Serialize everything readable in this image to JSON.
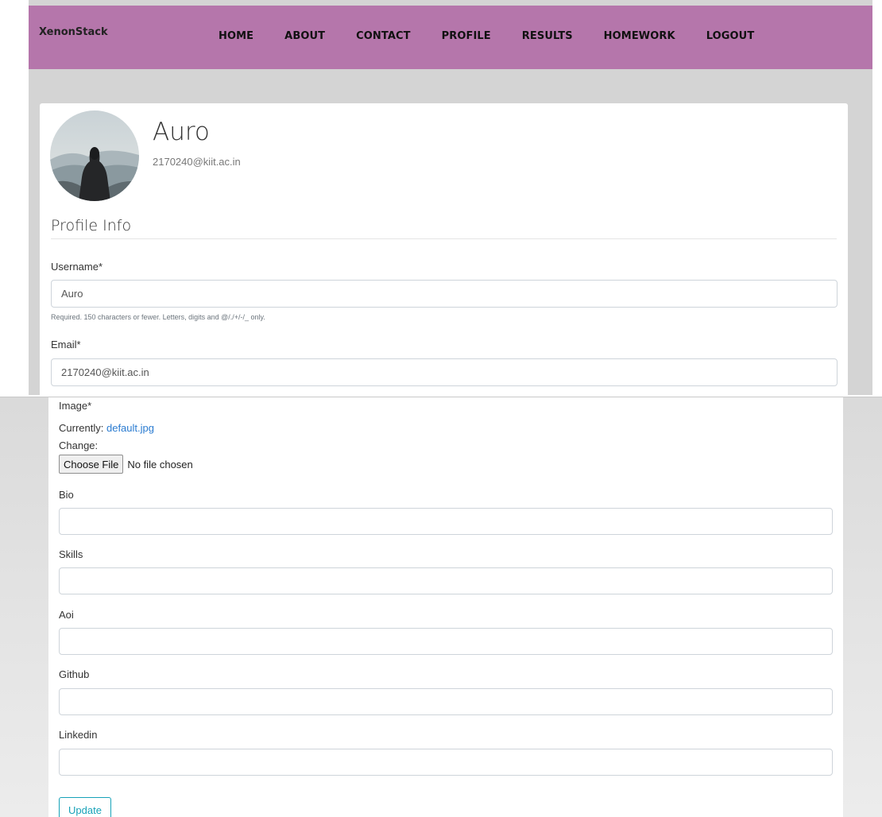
{
  "navbar": {
    "brand": "XenonStack",
    "links": [
      "HOME",
      "ABOUT",
      "CONTACT",
      "PROFILE",
      "RESULTS",
      "HOMEWORK",
      "LOGOUT"
    ],
    "background": "#b576ab"
  },
  "profile": {
    "name": "Auro",
    "email": "2170240@kiit.ac.in",
    "avatar_icon": "hooded-figure-avatar"
  },
  "section_title": "Profile Info",
  "form": {
    "username": {
      "label": "Username*",
      "value": "Auro",
      "help": "Required. 150 characters or fewer. Letters, digits and @/./+/-/_ only."
    },
    "email": {
      "label": "Email*",
      "value": "2170240@kiit.ac.in"
    },
    "image": {
      "label": "Image*",
      "currently_label": "Currently:",
      "current_file": "default.jpg",
      "change_label": "Change:",
      "choose_button": "Choose File",
      "no_file_text": "No file chosen"
    },
    "bio": {
      "label": "Bio",
      "value": ""
    },
    "skills": {
      "label": "Skills",
      "value": ""
    },
    "aoi": {
      "label": "Aoi",
      "value": ""
    },
    "github": {
      "label": "Github",
      "value": ""
    },
    "linkedin": {
      "label": "Linkedin",
      "value": ""
    },
    "submit_label": "Update"
  },
  "colors": {
    "accent": "#17a2b8",
    "link": "#2a7bd0",
    "page_background": "#d4d4d4"
  }
}
